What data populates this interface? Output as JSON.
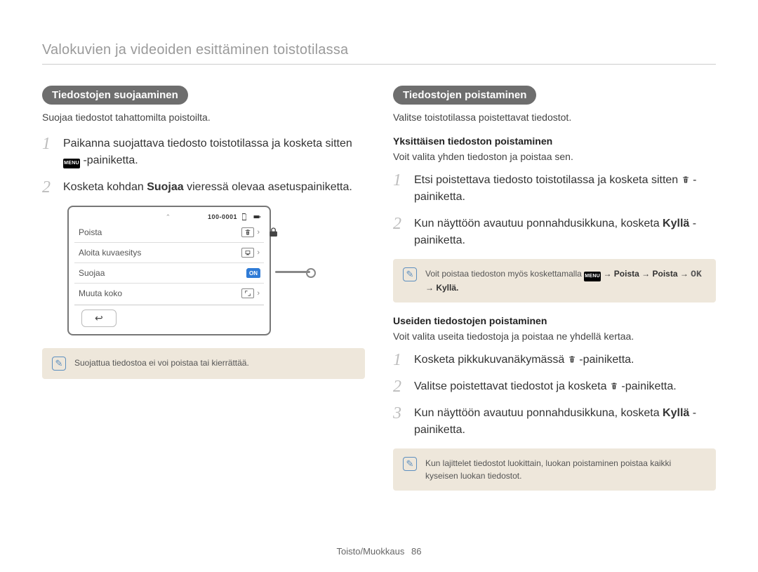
{
  "header": "Valokuvien ja videoiden esittäminen toistotilassa",
  "left": {
    "badge": "Tiedostojen suojaaminen",
    "intro": "Suojaa tiedostot tahattomilta poistoilta.",
    "step1_a": "Paikanna suojattava tiedosto toistotilassa ja kosketa sitten ",
    "step1_menu": "MENU",
    "step1_b": " -painiketta.",
    "step2_a": "Kosketa kohdan ",
    "step2_strong": "Suojaa",
    "step2_b": " vieressä olevaa asetuspainiketta.",
    "note": "Suojattua tiedostoa ei voi poistaa tai kierrättää."
  },
  "cam": {
    "counter": "100-0001",
    "rows": [
      {
        "label": "Poista",
        "icon": "trash"
      },
      {
        "label": "Aloita kuvaesitys",
        "icon": "slideshow"
      },
      {
        "label": "Suojaa",
        "icon": "on"
      },
      {
        "label": "Muuta koko",
        "icon": "resize"
      }
    ]
  },
  "right": {
    "badge": "Tiedostojen poistaminen",
    "intro": "Valitse toistotilassa poistettavat tiedostot.",
    "sec1_h": "Yksittäisen tiedoston poistaminen",
    "sec1_p": "Voit valita yhden tiedoston ja poistaa sen.",
    "sec1_step1_a": "Etsi poistettava tiedosto toistotilassa ja kosketa sitten ",
    "sec1_step1_b": " -painiketta.",
    "sec1_step2_a": "Kun näyttöön avautuu ponnahdusikkuna, kosketa ",
    "sec1_step2_strong": "Kyllä",
    "sec1_step2_b": "-painiketta.",
    "note1_a": "Voit poistaa tiedoston myös koskettamalla ",
    "note1_menu": "MENU",
    "note1_seq": " → Poista → Poista → ",
    "note1_ok": "OK",
    "note1_b": " → Kyllä.",
    "sec2_h": "Useiden tiedostojen poistaminen",
    "sec2_p": "Voit valita useita tiedostoja ja poistaa ne yhdellä kertaa.",
    "sec2_step1_a": "Kosketa pikkukuvanäkymässä ",
    "sec2_step1_b": "-painiketta.",
    "sec2_step2_a": "Valitse poistettavat tiedostot ja kosketa ",
    "sec2_step2_b": "-painiketta.",
    "sec2_step3_a": "Kun näyttöön avautuu ponnahdusikkuna, kosketa ",
    "sec2_step3_strong": "Kyllä",
    "sec2_step3_b": "-painiketta.",
    "note2": "Kun lajittelet tiedostot luokittain, luokan poistaminen poistaa kaikki kyseisen luokan tiedostot."
  },
  "footer": {
    "section": "Toisto/Muokkaus",
    "page": "86"
  }
}
